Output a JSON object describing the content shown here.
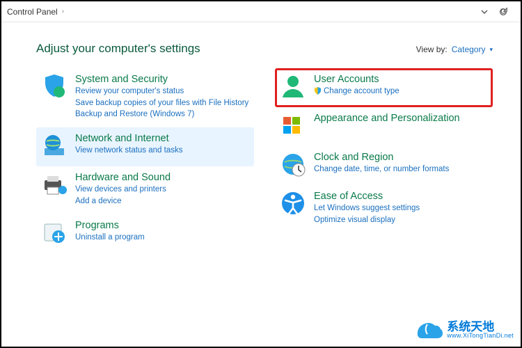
{
  "breadcrumb": {
    "root": "Control Panel"
  },
  "heading": "Adjust your computer's settings",
  "viewby": {
    "label": "View by:",
    "value": "Category"
  },
  "left": [
    {
      "title": "System and Security",
      "subs": [
        "Review your computer's status",
        "Save backup copies of your files with File History",
        "Backup and Restore (Windows 7)"
      ]
    },
    {
      "title": "Network and Internet",
      "subs": [
        "View network status and tasks"
      ]
    },
    {
      "title": "Hardware and Sound",
      "subs": [
        "View devices and printers",
        "Add a device"
      ]
    },
    {
      "title": "Programs",
      "subs": [
        "Uninstall a program"
      ]
    }
  ],
  "right": [
    {
      "title": "User Accounts",
      "subs": [
        "Change account type"
      ]
    },
    {
      "title": "Appearance and Personalization",
      "subs": []
    },
    {
      "title": "Clock and Region",
      "subs": [
        "Change date, time, or number formats"
      ]
    },
    {
      "title": "Ease of Access",
      "subs": [
        "Let Windows suggest settings",
        "Optimize visual display"
      ]
    }
  ],
  "watermark": {
    "cn": "系统天地",
    "url": "www.XiTongTianDi.net"
  }
}
